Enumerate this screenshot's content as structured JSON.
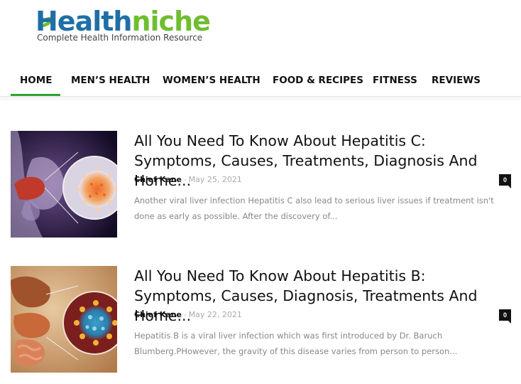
{
  "site": {
    "logo_part1": "Health",
    "logo_part2": "niche",
    "tagline": "Complete Health Information Resource"
  },
  "nav": {
    "items": [
      {
        "label": "HOME",
        "active": true
      },
      {
        "label": "MEN’S HEALTH"
      },
      {
        "label": "WOMEN’S HEALTH"
      },
      {
        "label": "FOOD & RECIPES"
      },
      {
        "label": "FITNESS"
      },
      {
        "label": "REVIEWS"
      }
    ]
  },
  "articles": [
    {
      "title": "All You Need To Know About Hepatitis C: Symptoms, Causes, Treatments, Diagnosis And Home...",
      "author": "Chief Kane",
      "separator": "-",
      "date": "May 25, 2021",
      "comments": "0",
      "excerpt": "Another viral liver infection Hepatitis C also lead to serious liver issues if treatment isn't done as early as possible. After the discovery of..."
    },
    {
      "title": "All You Need To Know About Hepatitis B: Symptoms, Causes, Diagnosis, Treatments And Home...",
      "author": "Chief Kane",
      "separator": "-",
      "date": "May 22, 2021",
      "comments": "0",
      "excerpt": "Hepatitis B is a viral liver infection which was first introduced by Dr. Baruch Blumberg.PHowever, the gravity of this disease varies from person to person..."
    }
  ],
  "colors": {
    "logo_blue": "#1f6fa6",
    "logo_green": "#6fbe2f",
    "nav_active": "#2ea32f"
  }
}
